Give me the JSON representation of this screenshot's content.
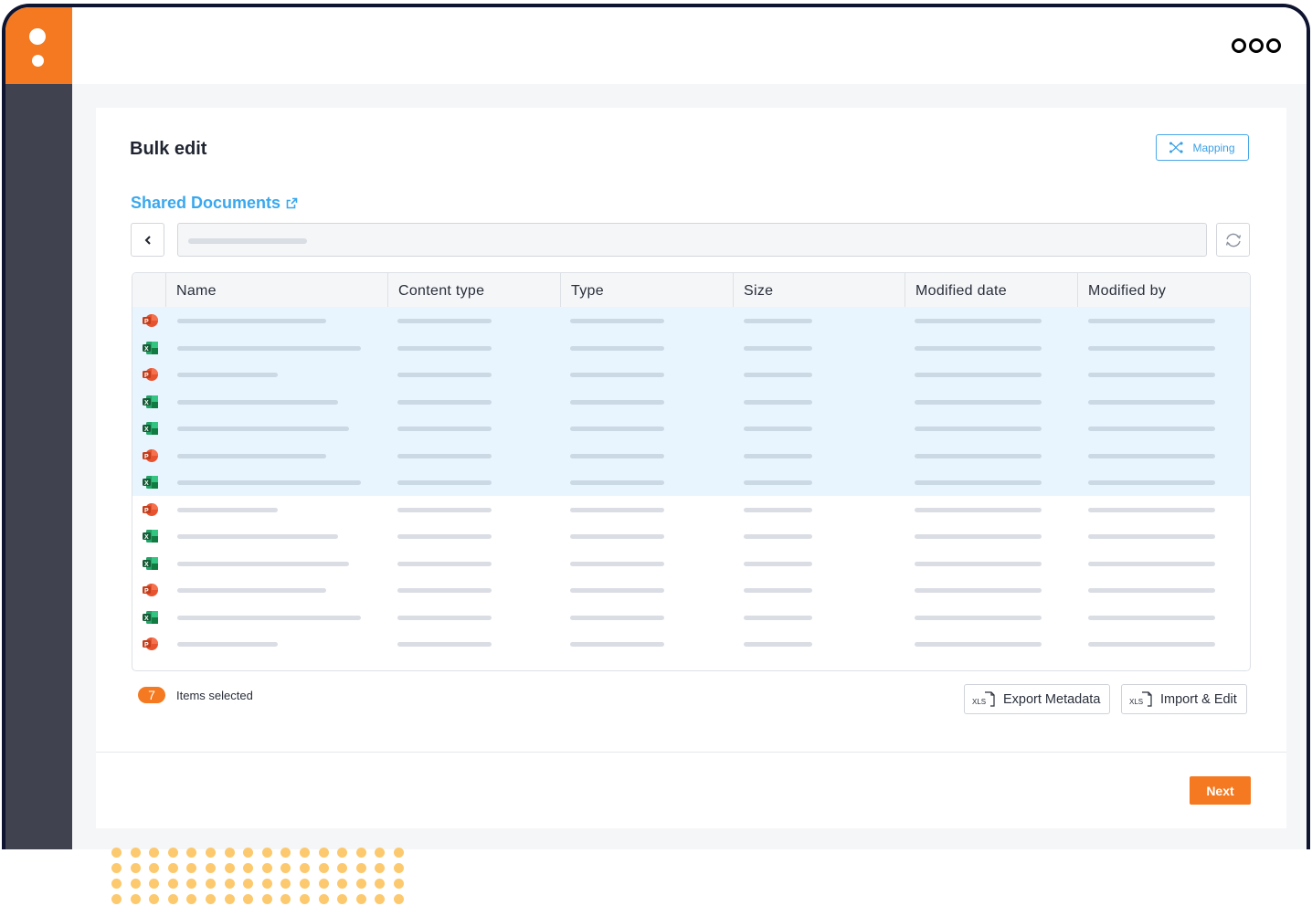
{
  "app": {
    "menu_icon": "more-circles-icon"
  },
  "page": {
    "title": "Bulk edit",
    "mapping_button": {
      "label": "Mapping",
      "icon": "shuffle-icon"
    },
    "breadcrumb": {
      "label": "Shared Documents",
      "icon": "external-link-icon"
    },
    "path_input": {
      "value": "",
      "icon_back": "chevron-left-icon",
      "icon_refresh": "refresh-icon"
    }
  },
  "table": {
    "columns": [
      "Name",
      "Content type",
      "Type",
      "Size",
      "Modified date",
      "Modified by"
    ],
    "rows": [
      {
        "file_type": "pptx",
        "selected": true
      },
      {
        "file_type": "xlsx",
        "selected": true
      },
      {
        "file_type": "pptx",
        "selected": true
      },
      {
        "file_type": "xlsx",
        "selected": true
      },
      {
        "file_type": "xlsx",
        "selected": true
      },
      {
        "file_type": "pptx",
        "selected": true
      },
      {
        "file_type": "xlsx",
        "selected": true
      },
      {
        "file_type": "pptx",
        "selected": false
      },
      {
        "file_type": "xlsx",
        "selected": false
      },
      {
        "file_type": "xlsx",
        "selected": false
      },
      {
        "file_type": "pptx",
        "selected": false
      },
      {
        "file_type": "xlsx",
        "selected": false
      },
      {
        "file_type": "pptx",
        "selected": false
      }
    ]
  },
  "footer": {
    "selected_count": "7",
    "selected_label": "Items selected",
    "export_button": "Export Metadata",
    "import_button": "Import & Edit",
    "xls_icon_label": "XLS",
    "next_button": "Next"
  },
  "colors": {
    "accent": "#f47920",
    "link": "#3aa8ee",
    "sidebar": "#41424f",
    "selected_row": "#e9f5fe",
    "decor_dots": "#fcc96e"
  }
}
